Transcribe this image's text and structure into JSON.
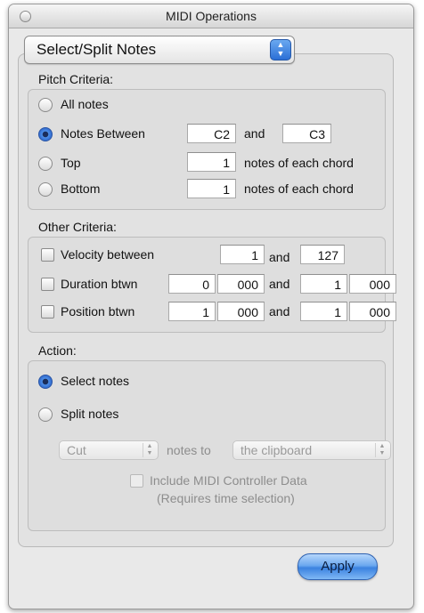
{
  "window": {
    "title": "MIDI Operations"
  },
  "mode_select": {
    "value": "Select/Split Notes"
  },
  "pitch": {
    "section_label": "Pitch Criteria:",
    "all_notes": "All notes",
    "notes_between": "Notes Between",
    "low_value": "C2",
    "and": "and",
    "high_value": "C3",
    "top": "Top",
    "top_value": "1",
    "top_suffix": "notes of each chord",
    "bottom": "Bottom",
    "bottom_value": "1",
    "bottom_suffix": "notes of each chord",
    "selected": "notes_between"
  },
  "other": {
    "section_label": "Other Criteria:",
    "velocity_label": "Velocity between",
    "velocity_min": "1",
    "velocity_and": "and",
    "velocity_max": "127",
    "duration_label": "Duration btwn",
    "duration_min_a": "0",
    "duration_min_b": "000",
    "duration_and": "and",
    "duration_max_a": "1",
    "duration_max_b": "000",
    "position_label": "Position btwn",
    "position_min_a": "1",
    "position_min_b": "000",
    "position_and": "and",
    "position_max_a": "1",
    "position_max_b": "000"
  },
  "action": {
    "section_label": "Action:",
    "select_notes": "Select notes",
    "split_notes": "Split notes",
    "selected": "select_notes",
    "cut_value": "Cut",
    "notes_to": "notes to",
    "destination_value": "the clipboard",
    "include_controller": "Include MIDI Controller Data",
    "requires_selection": "(Requires time selection)"
  },
  "buttons": {
    "apply": "Apply"
  },
  "colors": {
    "accent": "#3b82e0",
    "window_bg": "#e9e9e9"
  }
}
